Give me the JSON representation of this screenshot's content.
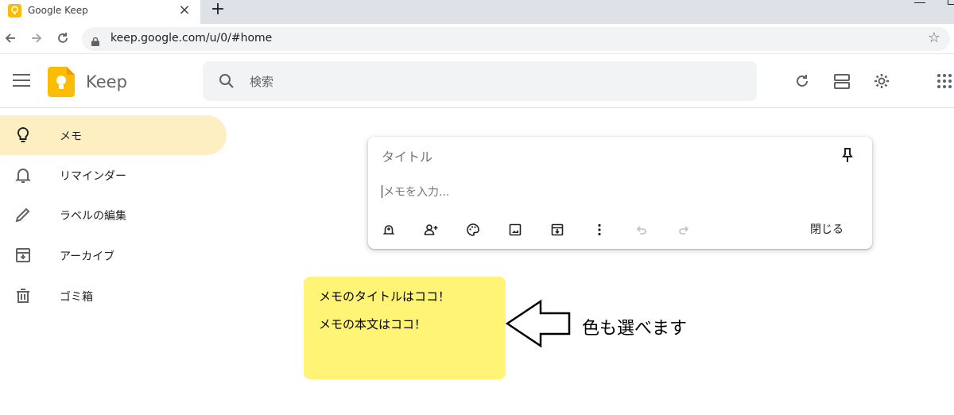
{
  "browser": {
    "tab_title": "Google Keep",
    "tab_close": "×",
    "new_tab": "+",
    "url": "keep.google.com/u/0/#home"
  },
  "app": {
    "name": "Keep",
    "search_placeholder": "検索"
  },
  "sidebar": {
    "items": [
      {
        "label": "メモ",
        "icon": "lightbulb-icon",
        "active": true
      },
      {
        "label": "リマインダー",
        "icon": "bell-icon",
        "active": false
      },
      {
        "label": "ラベルの編集",
        "icon": "pencil-icon",
        "active": false
      },
      {
        "label": "アーカイブ",
        "icon": "archive-icon",
        "active": false
      },
      {
        "label": "ゴミ箱",
        "icon": "trash-icon",
        "active": false
      }
    ]
  },
  "composer": {
    "title_placeholder": "タイトル",
    "body_placeholder": "メモを入力...",
    "close_label": "閉じる",
    "tools": [
      "reminder-icon",
      "collaborator-icon",
      "palette-icon",
      "image-icon",
      "archive-icon",
      "more-icon",
      "undo-icon",
      "redo-icon"
    ]
  },
  "annotation": {
    "note_title": "メモのタイトルはココ！",
    "note_body": "メモの本文はココ！",
    "note_color": "#fff475",
    "arrow_text": "色も選べます"
  },
  "colors": {
    "active_bg": "#feefc3",
    "keep_yellow": "#fbbc04",
    "search_bg": "#f1f3f4"
  }
}
